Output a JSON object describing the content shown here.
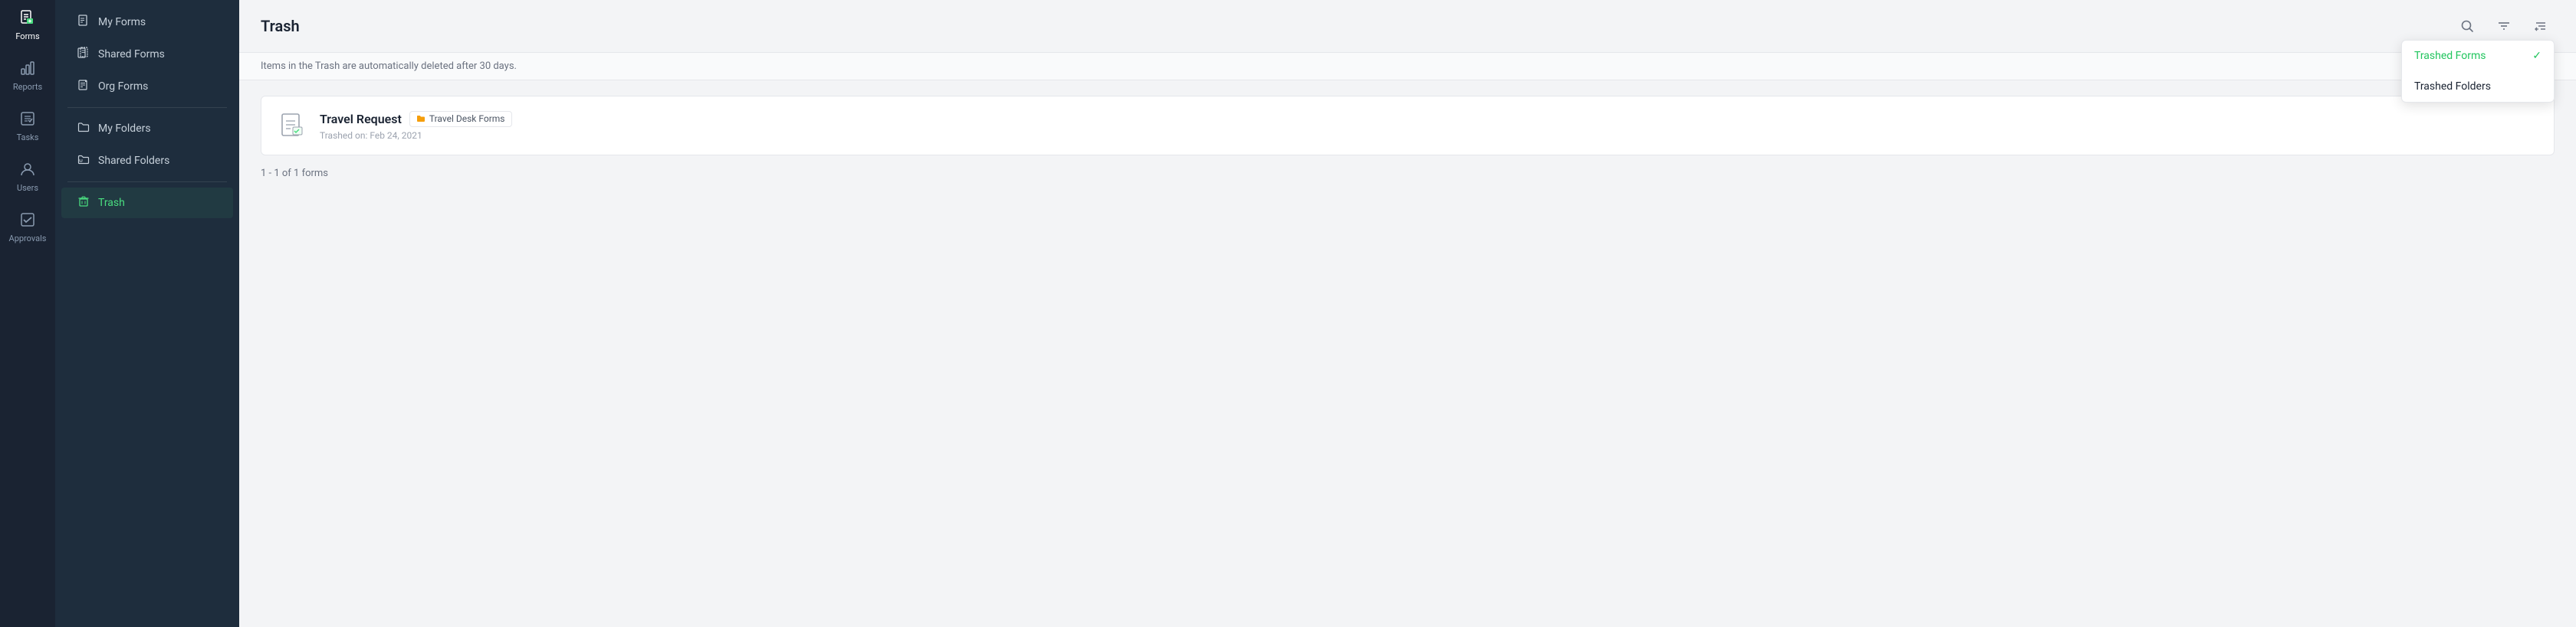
{
  "iconRail": {
    "items": [
      {
        "id": "forms",
        "label": "Forms",
        "icon": "🗋",
        "active": true
      },
      {
        "id": "reports",
        "label": "Reports",
        "icon": "📊",
        "active": false
      },
      {
        "id": "tasks",
        "label": "Tasks",
        "icon": "☑",
        "active": false
      },
      {
        "id": "users",
        "label": "Users",
        "icon": "👤",
        "active": false
      },
      {
        "id": "approvals",
        "label": "Approvals",
        "icon": "✅",
        "active": false
      }
    ]
  },
  "sidebar": {
    "items": [
      {
        "id": "my-forms",
        "label": "My Forms",
        "icon": "📄",
        "active": false
      },
      {
        "id": "shared-forms",
        "label": "Shared Forms",
        "icon": "📋",
        "active": false
      },
      {
        "id": "org-forms",
        "label": "Org Forms",
        "icon": "📑",
        "active": false
      },
      {
        "id": "my-folders",
        "label": "My Folders",
        "icon": "📁",
        "active": false
      },
      {
        "id": "shared-folders",
        "label": "Shared Folders",
        "icon": "🗂",
        "active": false
      },
      {
        "id": "trash",
        "label": "Trash",
        "icon": "🗑",
        "active": true
      }
    ]
  },
  "header": {
    "title": "Trash",
    "searchLabel": "Search",
    "filterLabel": "Filter",
    "sortLabel": "Sort"
  },
  "infoBar": {
    "text": "Items in the Trash are automatically deleted after 30 days."
  },
  "formCard": {
    "title": "Travel Request",
    "badge": "Travel Desk Forms",
    "badgeIcon": "📁",
    "subtitle": "Trashed on: Feb 24, 2021"
  },
  "pagination": {
    "text": "1 - 1 of 1 forms"
  },
  "dropdown": {
    "items": [
      {
        "id": "trashed-forms",
        "label": "Trashed Forms",
        "selected": true
      },
      {
        "id": "trashed-folders",
        "label": "Trashed Folders",
        "selected": false
      }
    ]
  }
}
